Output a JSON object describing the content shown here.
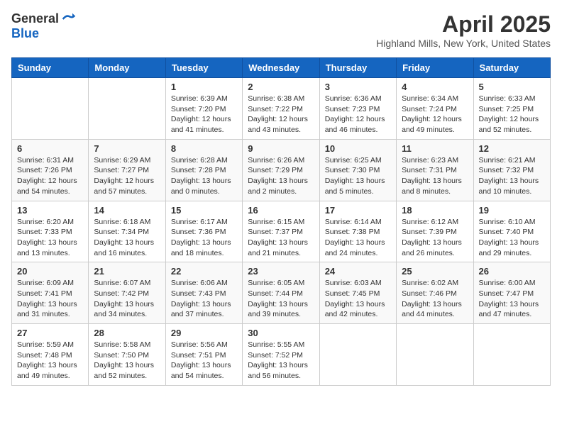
{
  "header": {
    "logo_general": "General",
    "logo_blue": "Blue",
    "title": "April 2025",
    "location": "Highland Mills, New York, United States"
  },
  "days_of_week": [
    "Sunday",
    "Monday",
    "Tuesday",
    "Wednesday",
    "Thursday",
    "Friday",
    "Saturday"
  ],
  "weeks": [
    [
      null,
      null,
      {
        "day": 1,
        "sunrise": "6:39 AM",
        "sunset": "7:20 PM",
        "daylight": "12 hours and 41 minutes."
      },
      {
        "day": 2,
        "sunrise": "6:38 AM",
        "sunset": "7:22 PM",
        "daylight": "12 hours and 43 minutes."
      },
      {
        "day": 3,
        "sunrise": "6:36 AM",
        "sunset": "7:23 PM",
        "daylight": "12 hours and 46 minutes."
      },
      {
        "day": 4,
        "sunrise": "6:34 AM",
        "sunset": "7:24 PM",
        "daylight": "12 hours and 49 minutes."
      },
      {
        "day": 5,
        "sunrise": "6:33 AM",
        "sunset": "7:25 PM",
        "daylight": "12 hours and 52 minutes."
      }
    ],
    [
      {
        "day": 6,
        "sunrise": "6:31 AM",
        "sunset": "7:26 PM",
        "daylight": "12 hours and 54 minutes."
      },
      {
        "day": 7,
        "sunrise": "6:29 AM",
        "sunset": "7:27 PM",
        "daylight": "12 hours and 57 minutes."
      },
      {
        "day": 8,
        "sunrise": "6:28 AM",
        "sunset": "7:28 PM",
        "daylight": "13 hours and 0 minutes."
      },
      {
        "day": 9,
        "sunrise": "6:26 AM",
        "sunset": "7:29 PM",
        "daylight": "13 hours and 2 minutes."
      },
      {
        "day": 10,
        "sunrise": "6:25 AM",
        "sunset": "7:30 PM",
        "daylight": "13 hours and 5 minutes."
      },
      {
        "day": 11,
        "sunrise": "6:23 AM",
        "sunset": "7:31 PM",
        "daylight": "13 hours and 8 minutes."
      },
      {
        "day": 12,
        "sunrise": "6:21 AM",
        "sunset": "7:32 PM",
        "daylight": "13 hours and 10 minutes."
      }
    ],
    [
      {
        "day": 13,
        "sunrise": "6:20 AM",
        "sunset": "7:33 PM",
        "daylight": "13 hours and 13 minutes."
      },
      {
        "day": 14,
        "sunrise": "6:18 AM",
        "sunset": "7:34 PM",
        "daylight": "13 hours and 16 minutes."
      },
      {
        "day": 15,
        "sunrise": "6:17 AM",
        "sunset": "7:36 PM",
        "daylight": "13 hours and 18 minutes."
      },
      {
        "day": 16,
        "sunrise": "6:15 AM",
        "sunset": "7:37 PM",
        "daylight": "13 hours and 21 minutes."
      },
      {
        "day": 17,
        "sunrise": "6:14 AM",
        "sunset": "7:38 PM",
        "daylight": "13 hours and 24 minutes."
      },
      {
        "day": 18,
        "sunrise": "6:12 AM",
        "sunset": "7:39 PM",
        "daylight": "13 hours and 26 minutes."
      },
      {
        "day": 19,
        "sunrise": "6:10 AM",
        "sunset": "7:40 PM",
        "daylight": "13 hours and 29 minutes."
      }
    ],
    [
      {
        "day": 20,
        "sunrise": "6:09 AM",
        "sunset": "7:41 PM",
        "daylight": "13 hours and 31 minutes."
      },
      {
        "day": 21,
        "sunrise": "6:07 AM",
        "sunset": "7:42 PM",
        "daylight": "13 hours and 34 minutes."
      },
      {
        "day": 22,
        "sunrise": "6:06 AM",
        "sunset": "7:43 PM",
        "daylight": "13 hours and 37 minutes."
      },
      {
        "day": 23,
        "sunrise": "6:05 AM",
        "sunset": "7:44 PM",
        "daylight": "13 hours and 39 minutes."
      },
      {
        "day": 24,
        "sunrise": "6:03 AM",
        "sunset": "7:45 PM",
        "daylight": "13 hours and 42 minutes."
      },
      {
        "day": 25,
        "sunrise": "6:02 AM",
        "sunset": "7:46 PM",
        "daylight": "13 hours and 44 minutes."
      },
      {
        "day": 26,
        "sunrise": "6:00 AM",
        "sunset": "7:47 PM",
        "daylight": "13 hours and 47 minutes."
      }
    ],
    [
      {
        "day": 27,
        "sunrise": "5:59 AM",
        "sunset": "7:48 PM",
        "daylight": "13 hours and 49 minutes."
      },
      {
        "day": 28,
        "sunrise": "5:58 AM",
        "sunset": "7:50 PM",
        "daylight": "13 hours and 52 minutes."
      },
      {
        "day": 29,
        "sunrise": "5:56 AM",
        "sunset": "7:51 PM",
        "daylight": "13 hours and 54 minutes."
      },
      {
        "day": 30,
        "sunrise": "5:55 AM",
        "sunset": "7:52 PM",
        "daylight": "13 hours and 56 minutes."
      },
      null,
      null,
      null
    ]
  ]
}
